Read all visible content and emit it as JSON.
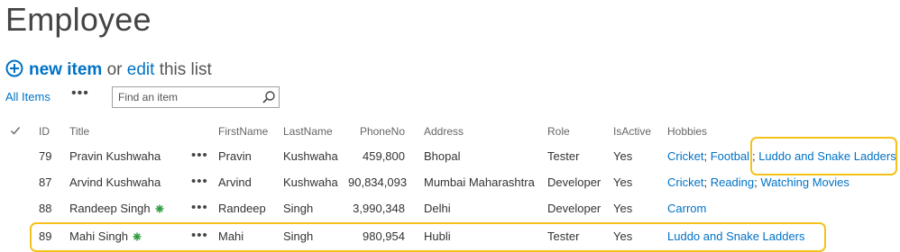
{
  "page": {
    "title": "Employee"
  },
  "commands": {
    "new_item": "new item",
    "or": "or",
    "edit": "edit",
    "this_list": "this list"
  },
  "view": {
    "current": "All Items",
    "more": "•••",
    "search_placeholder": "Find an item"
  },
  "columns": {
    "id": "ID",
    "title": "Title",
    "first": "FirstName",
    "last": "LastName",
    "phone": "PhoneNo",
    "address": "Address",
    "role": "Role",
    "active": "IsActive",
    "hobbies": "Hobbies"
  },
  "rows": [
    {
      "id": "79",
      "title": "Pravin Kushwaha",
      "more": "•••",
      "first": "Pravin",
      "last": "Kushwaha",
      "phone": "459,800",
      "address": "Bhopal",
      "role": "Tester",
      "active": "Yes",
      "hobbies": [
        "Cricket",
        "Football",
        "Luddo and Snake Ladders"
      ]
    },
    {
      "id": "87",
      "title": "Arvind Kushwaha",
      "more": "•••",
      "first": "Arvind",
      "last": "Kushwaha",
      "phone": "90,834,093",
      "address": "Mumbai Maharashtra",
      "role": "Developer",
      "active": "Yes",
      "hobbies": [
        "Cricket",
        "Reading",
        "Watching Movies"
      ]
    },
    {
      "id": "88",
      "title": "Randeep Singh",
      "more": "•••",
      "first": "Randeep",
      "last": "Singh",
      "phone": "3,990,348",
      "address": "Delhi",
      "role": "Developer",
      "active": "Yes",
      "hobbies": [
        "Carrom"
      ]
    },
    {
      "id": "89",
      "title": "Mahi Singh",
      "more": "•••",
      "first": "Mahi",
      "last": "Singh",
      "phone": "980,954",
      "address": "Hubli",
      "role": "Tester",
      "active": "Yes",
      "hobbies": [
        "Luddo and Snake Ladders"
      ]
    }
  ],
  "hobby_separator": ";",
  "colors": {
    "accent": "#0072c6",
    "highlight": "#f5c21b",
    "new_marker": "#2e9b3d"
  }
}
